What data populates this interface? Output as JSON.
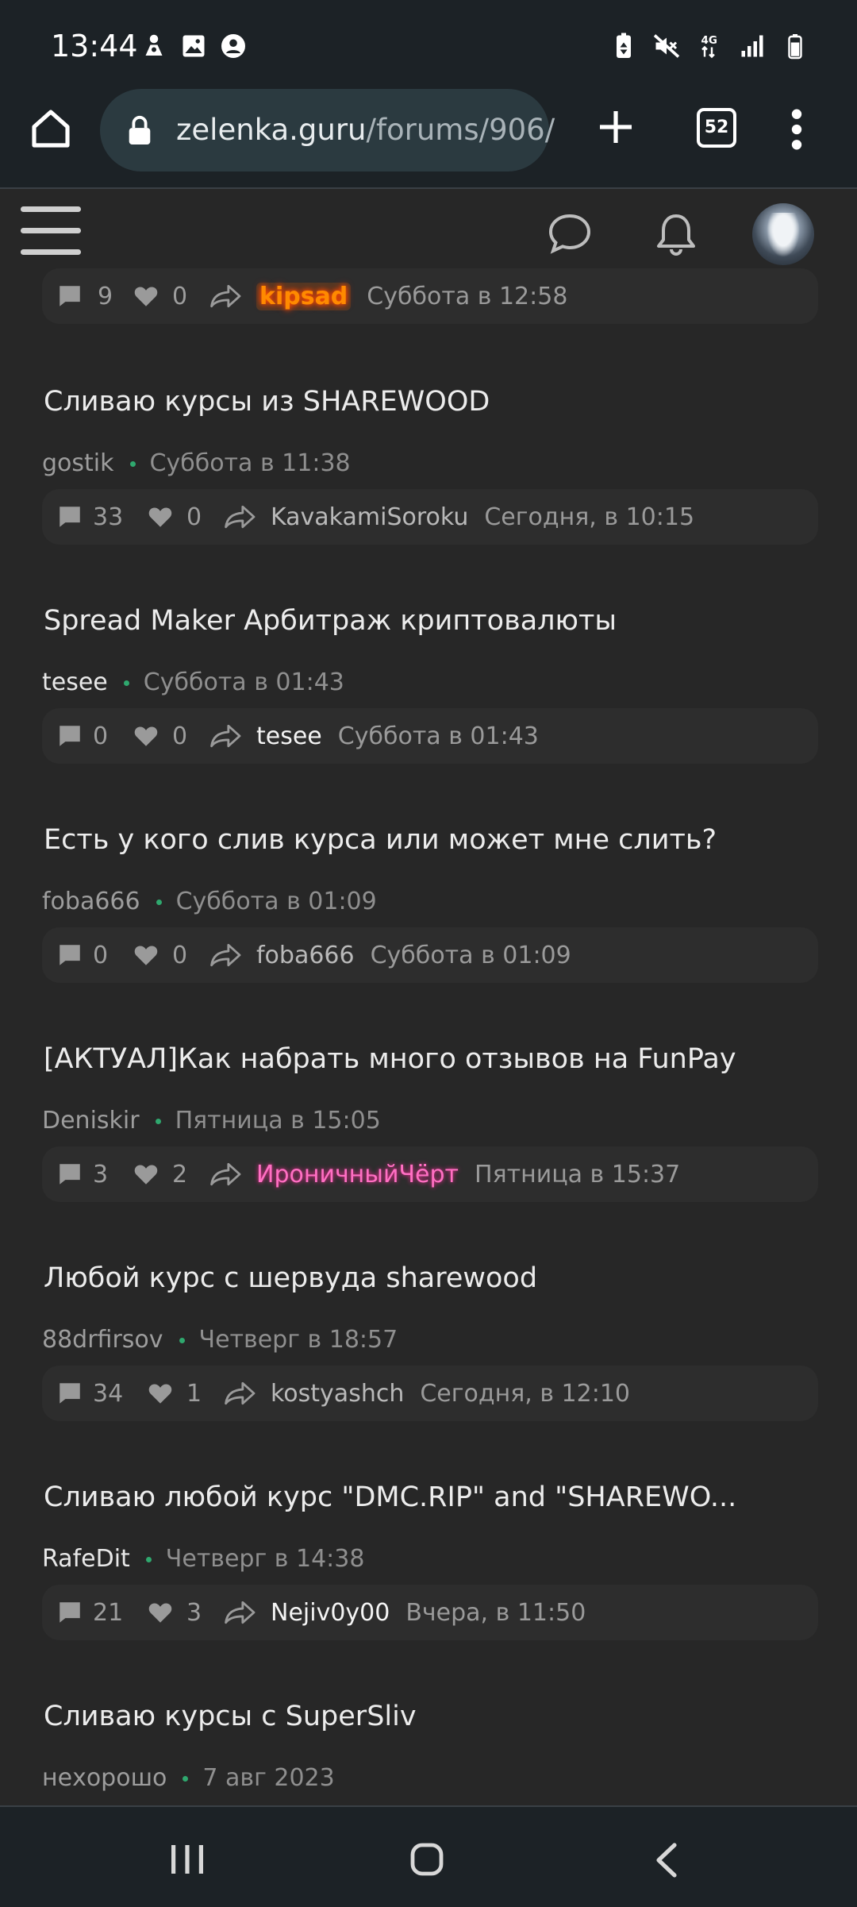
{
  "status_bar": {
    "time": "13:44",
    "left_icons": [
      "notification-icon",
      "image-icon",
      "account-icon"
    ],
    "right_icons": [
      "recycle-battery-icon",
      "mute-icon",
      "network-4g-icon",
      "signal-icon",
      "battery-icon"
    ],
    "network_label": "4G"
  },
  "browser": {
    "url_host": "zelenka.guru",
    "url_path": "/forums/906/",
    "tab_count": "52"
  },
  "threads": [
    {
      "title": "",
      "author": "",
      "date": "",
      "replies": "9",
      "likes": "0",
      "last_user": "kipsad",
      "last_user_style": "orange",
      "last_date": "Суббота в 12:58"
    },
    {
      "title": "Сливаю курсы из SHAREWOOD",
      "author": "gostik",
      "author_style": "grey",
      "date": "Суббота в 11:38",
      "replies": "33",
      "likes": "0",
      "last_user": "KavakamiSoroku",
      "last_user_style": "grey",
      "last_date": "Сегодня, в 10:15"
    },
    {
      "title": "Spread Maker Арбитраж криптовалюты",
      "author": "tesee",
      "author_style": "white",
      "date": "Суббота в 01:43",
      "replies": "0",
      "likes": "0",
      "last_user": "tesee",
      "last_user_style": "white",
      "last_date": "Суббота в 01:43"
    },
    {
      "title": "Есть у кого слив курса или может мне слить?",
      "author": "foba666",
      "author_style": "grey",
      "date": "Суббота в 01:09",
      "replies": "0",
      "likes": "0",
      "last_user": "foba666",
      "last_user_style": "grey",
      "last_date": "Суббота в 01:09"
    },
    {
      "title": "[АКТУАЛ]Как набрать много отзывов на FunPay",
      "author": "Deniskir",
      "author_style": "grey",
      "date": "Пятница в 15:05",
      "replies": "3",
      "likes": "2",
      "last_user": "ИроничныйЧёрт",
      "last_user_style": "pink",
      "last_date": "Пятница в 15:37"
    },
    {
      "title": "Любой курс с шервуда sharewood",
      "author": "88drfirsov",
      "author_style": "grey",
      "date": "Четверг в 18:57",
      "replies": "34",
      "likes": "1",
      "last_user": "kostyashch",
      "last_user_style": "grey",
      "last_date": "Сегодня, в 12:10"
    },
    {
      "title": "Сливаю любой курс \"DMC.RIP\" and \"SHAREWO...",
      "author": "RafeDit",
      "author_style": "white",
      "date": "Четверг в 14:38",
      "replies": "21",
      "likes": "3",
      "last_user": "Nejiv0y00",
      "last_user_style": "white",
      "last_date": "Вчера, в 11:50"
    },
    {
      "title": "Сливаю курсы с SuperSliv",
      "author": "нехорошо",
      "author_style": "grey",
      "date": "7 авг 2023",
      "replies": "",
      "likes": "",
      "last_user": "",
      "last_user_style": "grey",
      "last_date": ""
    }
  ],
  "colors": {
    "background": "#272727",
    "chrome": "#1c2226",
    "url_bar": "#2b3a40",
    "stats_bar": "#2d2d2d",
    "online_dot": "#2fa86e",
    "highlight_orange": "#ff8a00",
    "highlight_pink": "#ff6fc3"
  }
}
